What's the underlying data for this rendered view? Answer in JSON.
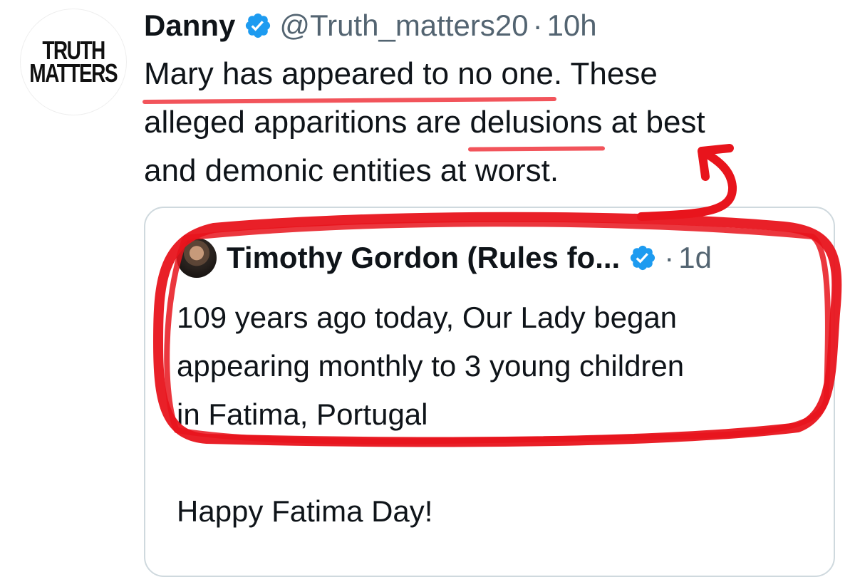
{
  "tweet": {
    "avatar": {
      "logo_line1": "TRUTH",
      "logo_line2": "MATTERS"
    },
    "display_name": "Danny",
    "handle": "@Truth_matters20",
    "separator": "·",
    "time": "10h",
    "text_lines": {
      "line1_underlined": "Mary has appeared to no one",
      "line1_rest": ". These",
      "line2_start": "alleged apparitions are ",
      "line2_underlined": "delusions",
      "line2_end": " at best",
      "line3": "and demonic entities at worst."
    }
  },
  "quote": {
    "display_name": "Timothy Gordon (Rules fo...",
    "separator": "·",
    "time": "1d",
    "text_lines": [
      "109 years ago today, Our Lady began",
      "appearing monthly to 3 young children",
      "in Fatima, Portugal"
    ],
    "footer_line": "Happy Fatima Day!"
  },
  "colors": {
    "verified_badge": "#1d9bf0",
    "secondary_text": "#536471",
    "annotation_red": "#e8141c",
    "underline_red": "#f2545b",
    "card_border": "#cfd9de"
  },
  "icons": {
    "verified": "verified-badge-icon"
  }
}
